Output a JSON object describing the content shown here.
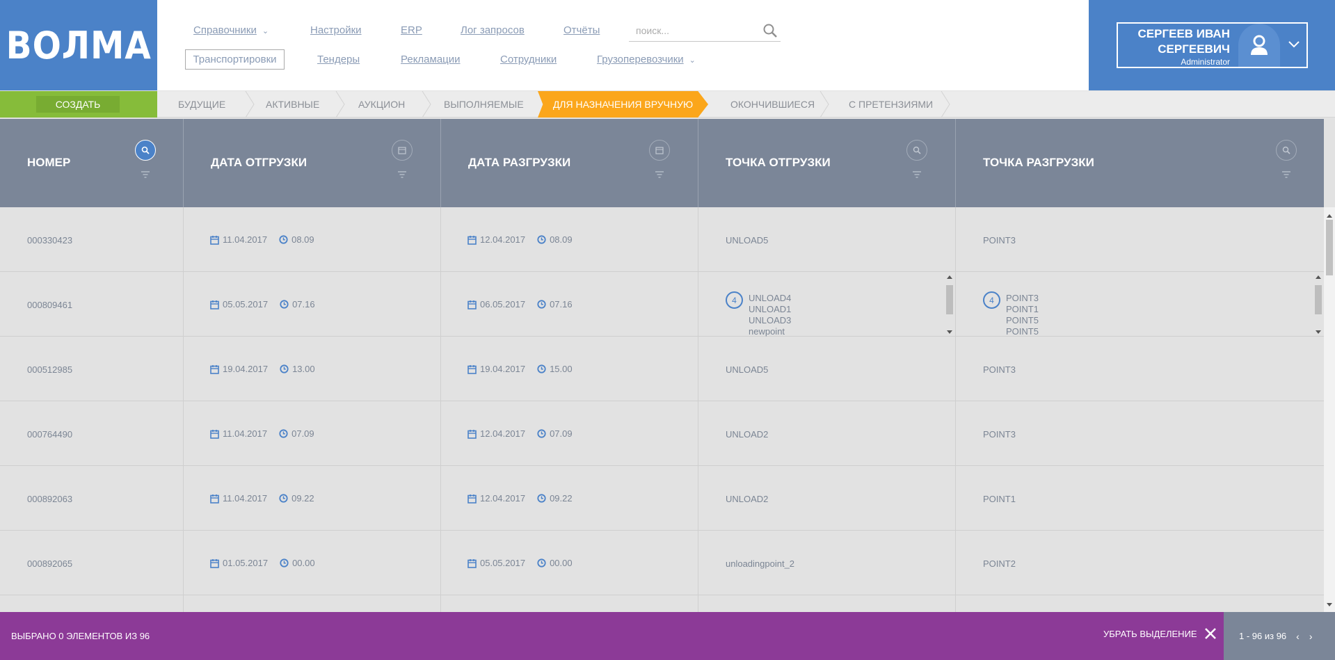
{
  "logo": "ВОЛМА",
  "nav": {
    "row1": [
      {
        "label": "Справочники",
        "dropdown": true
      },
      {
        "label": "Настройки"
      },
      {
        "label": "ERP"
      },
      {
        "label": "Лог запросов"
      },
      {
        "label": "Отчёты"
      }
    ],
    "row2": [
      {
        "label": "Транспортировки",
        "active": true
      },
      {
        "label": "Тендеры"
      },
      {
        "label": "Рекламации"
      },
      {
        "label": "Сотрудники"
      },
      {
        "label": "Грузоперевозчики",
        "dropdown": true
      }
    ],
    "search_placeholder": "поиск..."
  },
  "user": {
    "name_line1": "СЕРГЕЕВ ИВАН",
    "name_line2": "СЕРГЕЕВИЧ",
    "role": "Administrator"
  },
  "tabs": {
    "create_label": "СОЗДАТЬ",
    "items": [
      "БУДУЩИЕ",
      "АКТИВНЫЕ",
      "АУКЦИОН",
      "ВЫПОЛНЯЕМЫЕ",
      "ДЛЯ НАЗНАЧЕНИЯ ВРУЧНУЮ",
      "ОКОНЧИВШИЕСЯ",
      "С ПРЕТЕНЗИЯМИ"
    ],
    "active_index": 4
  },
  "columns": [
    "НОМЕР",
    "ДАТА ОТГРУЗКИ",
    "ДАТА РАЗГРУЗКИ",
    "ТОЧКА ОТГРУЗКИ",
    "ТОЧКА РАЗГРУЗКИ"
  ],
  "rows": [
    {
      "number": "000330423",
      "ship_date": "11.04.2017",
      "ship_time": "08.09",
      "unload_date": "12.04.2017",
      "unload_time": "08.09",
      "ship_point": "UNLOAD5",
      "unload_point": "POINT3"
    },
    {
      "number": "000809461",
      "ship_date": "05.05.2017",
      "ship_time": "07.16",
      "unload_date": "06.05.2017",
      "unload_time": "07.16",
      "ship_points": {
        "count": "4",
        "items": [
          "UNLOAD4",
          "UNLOAD1",
          "UNLOAD3",
          "newpoint"
        ]
      },
      "unload_points": {
        "count": "4",
        "items": [
          "POINT3",
          "POINT1",
          "POINT5",
          "POINT5"
        ]
      }
    },
    {
      "number": "000512985",
      "ship_date": "19.04.2017",
      "ship_time": "13.00",
      "unload_date": "19.04.2017",
      "unload_time": "15.00",
      "ship_point": "UNLOAD5",
      "unload_point": "POINT3"
    },
    {
      "number": "000764490",
      "ship_date": "11.04.2017",
      "ship_time": "07.09",
      "unload_date": "12.04.2017",
      "unload_time": "07.09",
      "ship_point": "UNLOAD2",
      "unload_point": "POINT3"
    },
    {
      "number": "000892063",
      "ship_date": "11.04.2017",
      "ship_time": "09.22",
      "unload_date": "12.04.2017",
      "unload_time": "09.22",
      "ship_point": "UNLOAD2",
      "unload_point": "POINT1"
    },
    {
      "number": "000892065",
      "ship_date": "01.05.2017",
      "ship_time": "00.00",
      "unload_date": "05.05.2017",
      "unload_time": "00.00",
      "ship_point": "unloadingpoint_2",
      "unload_point": "POINT2"
    }
  ],
  "footer": {
    "selected_text": "ВЫБРАНО 0 ЭЛЕМЕНТОВ ИЗ 96",
    "clear_label": "УБРАТЬ ВЫДЕЛЕНИЕ",
    "pager_text": "1 - 96 из 96"
  },
  "colors": {
    "brand_blue": "#4b82c8",
    "create_green": "#86bc3a",
    "active_tab_orange": "#fba61b",
    "header_gray": "#7b8698",
    "footer_purple": "#8c3a97"
  }
}
